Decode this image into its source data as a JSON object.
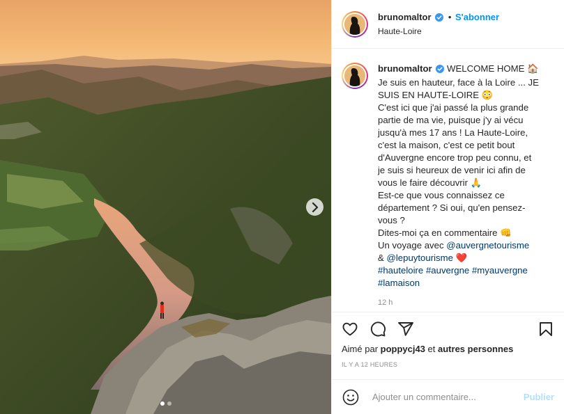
{
  "post": {
    "username": "brunomaltor",
    "separator": "•",
    "follow_label": "S'abonner",
    "location": "Haute-Loire"
  },
  "caption": {
    "username": "brunomaltor",
    "lines": {
      "l1_text": "WELCOME HOME 🏠",
      "l2": "Je suis en hauteur, face à la Loire ... JE",
      "l3": "SUIS EN HAUTE-LOIRE 😳",
      "l4": "C'est ici que j'ai passé la plus grande",
      "l5": "partie de ma vie, puisque j'y ai vécu",
      "l6": "jusqu'à mes 17 ans ! La Haute-Loire,",
      "l7": "c'est la maison, c'est ce petit bout",
      "l8": "d'Auvergne encore trop peu connu, et",
      "l9": "je suis si heureux de venir ici afin de",
      "l10": "vous le faire découvrir 🙏",
      "l11": "Est-ce que vous connaissez ce",
      "l12": "département ? Si oui, qu'en pensez-",
      "l13": "vous ?",
      "l14": "Dites-moi ça en commentaire 👊",
      "l15_prefix": "Un voyage avec ",
      "mention1": "@auvergnetourisme",
      "l16_prefix": "& ",
      "mention2": "@lepuytourisme",
      "l16_suffix": " ❤️",
      "tag1": "#hauteloire",
      "tag2": "#auvergne",
      "tag3": "#myauvergne",
      "tag4": "#lamaison"
    },
    "time": "12 h"
  },
  "likes": {
    "prefix": "Aimé par ",
    "user": "poppycj43",
    "middle": " et ",
    "others": "autres personnes"
  },
  "posted_ago": "IL Y A 12 HEURES",
  "comment_box": {
    "placeholder": "Ajouter un commentaire...",
    "publish_label": "Publier"
  },
  "icons": {
    "verified": "verified-badge-icon",
    "like": "heart-icon",
    "comment": "comment-bubble-icon",
    "share": "paper-plane-icon",
    "save": "bookmark-icon",
    "emoji": "smiley-icon",
    "next": "chevron-right-icon"
  },
  "colors": {
    "link_blue": "#0095f6",
    "mention_blue": "#00376b",
    "muted": "#8e8e8e",
    "publish_disabled": "#b2dffc"
  },
  "carousel": {
    "current": 1,
    "total": 2
  }
}
